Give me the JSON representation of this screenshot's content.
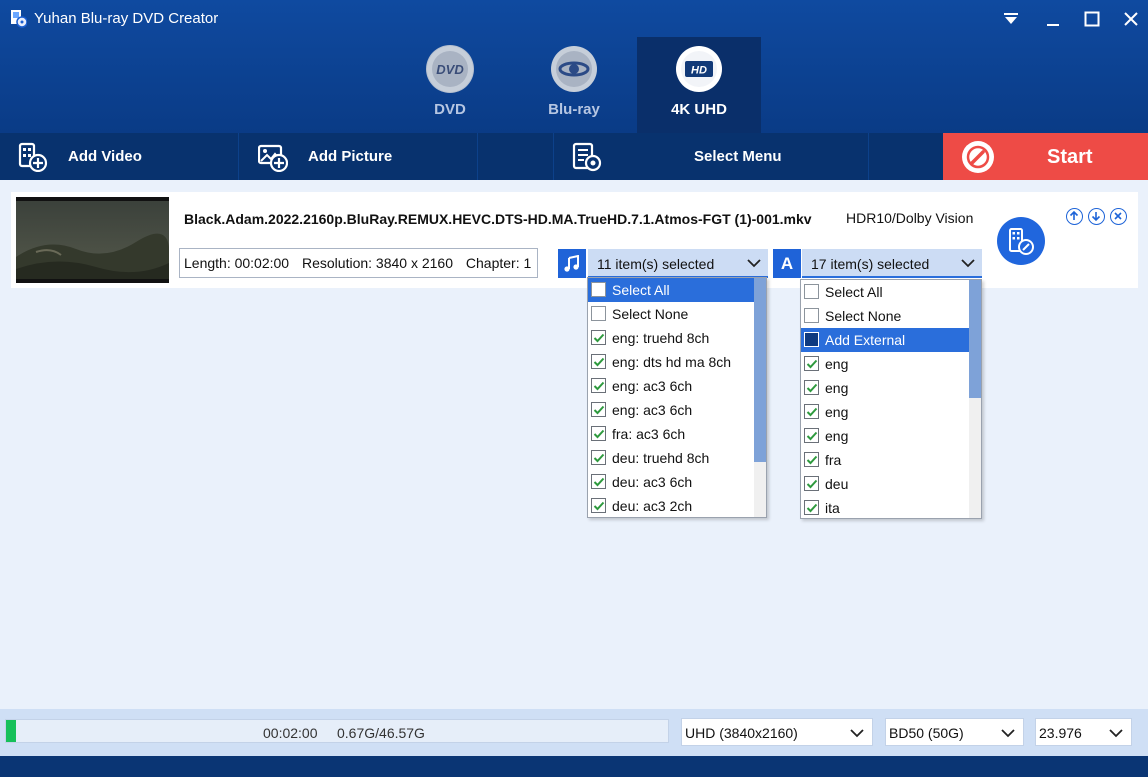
{
  "app": {
    "title": "Yuhan Blu-ray DVD Creator"
  },
  "modes": [
    {
      "label": "DVD",
      "icon": "dvd-disc-icon",
      "active": false
    },
    {
      "label": "Blu-ray",
      "icon": "bluray-disc-icon",
      "active": false
    },
    {
      "label": "4K UHD",
      "icon": "ultra-hd-disc-icon",
      "active": true
    }
  ],
  "toolbar": {
    "add_video": "Add Video",
    "add_picture": "Add Picture",
    "select_menu": "Select Menu",
    "start": "Start"
  },
  "video": {
    "file_name": "Black.Adam.2022.2160p.BluRay.REMUX.HEVC.DTS-HD.MA.TrueHD.7.1.Atmos-FGT (1)-001.mkv",
    "hdr": "HDR10/Dolby Vision",
    "length": "Length: 00:02:00",
    "resolution": "Resolution: 3840 x 2160",
    "chapter": "Chapter: 1"
  },
  "audio_select": {
    "summary": "11 item(s) selected",
    "items": [
      {
        "label": "Select All",
        "checked": false,
        "highlighted": true
      },
      {
        "label": "Select None",
        "checked": false
      },
      {
        "label": "eng: truehd 8ch",
        "checked": true
      },
      {
        "label": "eng: dts hd ma 8ch",
        "checked": true
      },
      {
        "label": "eng: ac3 6ch",
        "checked": true
      },
      {
        "label": "eng: ac3 6ch",
        "checked": true
      },
      {
        "label": "fra: ac3 6ch",
        "checked": true
      },
      {
        "label": "deu: truehd 8ch",
        "checked": true
      },
      {
        "label": "deu: ac3 6ch",
        "checked": true
      },
      {
        "label": "deu: ac3 2ch",
        "checked": true
      }
    ]
  },
  "subtitle_select": {
    "icon_letter": "A",
    "summary": "17 item(s) selected",
    "items": [
      {
        "label": "Select All",
        "checked": false
      },
      {
        "label": "Select None",
        "checked": false
      },
      {
        "label": "Add External",
        "checked": false,
        "highlighted": true
      },
      {
        "label": "eng",
        "checked": true
      },
      {
        "label": "eng",
        "checked": true
      },
      {
        "label": "eng",
        "checked": true
      },
      {
        "label": "eng",
        "checked": true
      },
      {
        "label": "fra",
        "checked": true
      },
      {
        "label": "deu",
        "checked": true
      },
      {
        "label": "ita",
        "checked": true
      }
    ]
  },
  "status": {
    "duration": "00:02:00",
    "size": "0.67G/46.57G",
    "progress_fraction": 0.0144,
    "resolution_option": "UHD (3840x2160)",
    "disc_option": "BD50 (50G)",
    "framerate_option": "23.976"
  },
  "colors": {
    "header_blue": "#0f4aa0",
    "toolbar_blue": "#08326e",
    "start_red": "#ee4b46",
    "accent_blue": "#2a6edb",
    "progress_green": "#16c05a"
  }
}
